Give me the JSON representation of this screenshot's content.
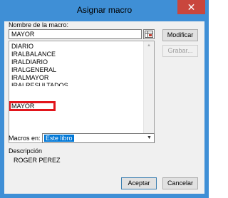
{
  "window": {
    "title": "Asignar macro",
    "close_glyph": "✕"
  },
  "macro_name": {
    "label": "Nombre de la macro:",
    "value": "MAYOR"
  },
  "macro_list": {
    "items": [
      "DIARIO",
      "IRALBALANCE",
      "IRALDIARIO",
      "IRALGENERAL",
      "IRALMAYOR",
      "IRALRESULTADOS",
      "MAYOR"
    ],
    "selected": "MAYOR",
    "highlight_color": "#e2151b"
  },
  "buttons": {
    "modify": "Modificar",
    "record": "Grabar...",
    "accept": "Aceptar",
    "cancel": "Cancelar"
  },
  "macros_in": {
    "label": "Macros en:",
    "value": "Este libro"
  },
  "description": {
    "label": "Descripción",
    "text": "ROGER PEREZ"
  },
  "colors": {
    "title_bar": "#3f8fd6",
    "close_button": "#c9463d",
    "selection": "#0078d7"
  },
  "icons": {
    "close": "close-icon",
    "range_select": "range-select-icon",
    "scroll_up": "scroll-up-icon",
    "scroll_down": "scroll-down-icon",
    "dropdown": "chevron-down-icon"
  }
}
